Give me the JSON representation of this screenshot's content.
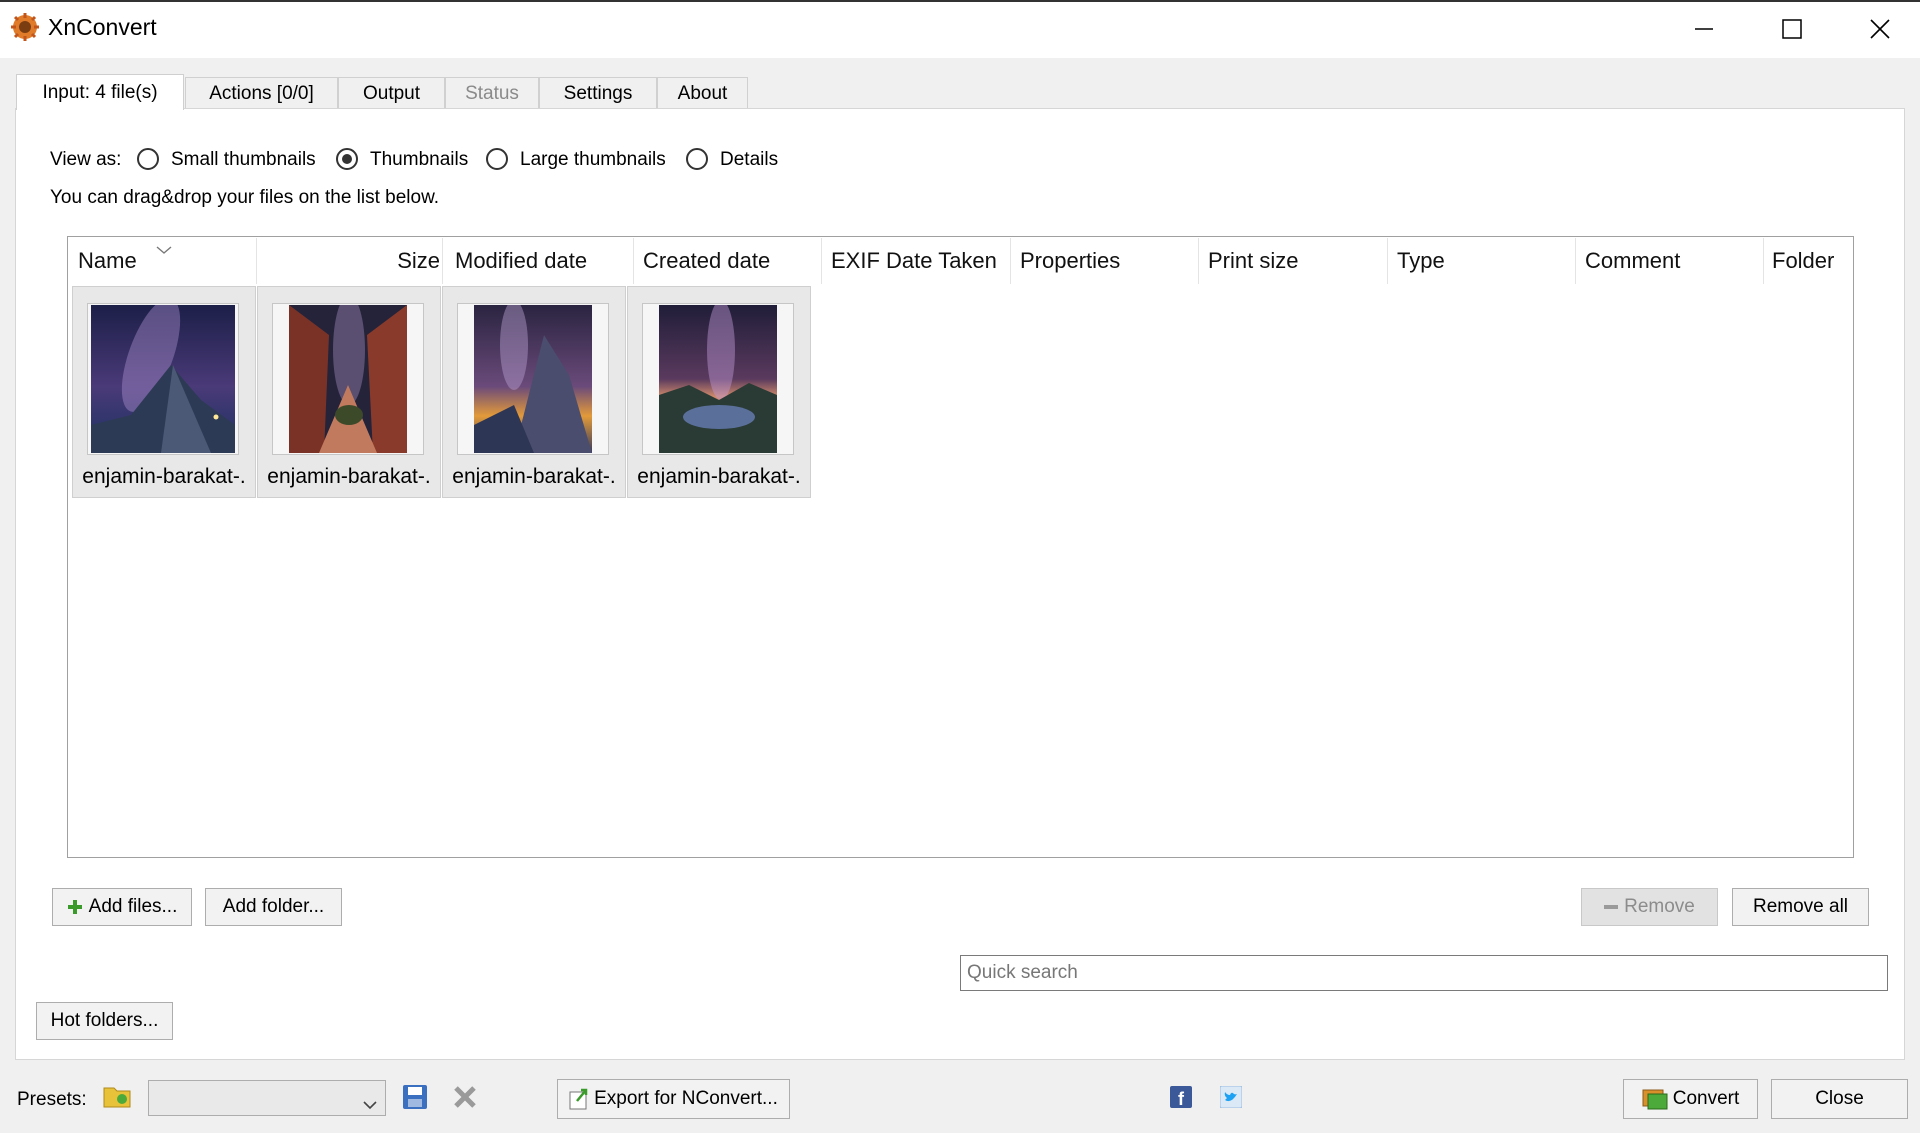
{
  "window": {
    "title": "XnConvert"
  },
  "tabs": [
    {
      "label": "Input: 4 file(s)",
      "active": true
    },
    {
      "label": "Actions [0/0]"
    },
    {
      "label": "Output"
    },
    {
      "label": "Status",
      "disabled": true
    },
    {
      "label": "Settings"
    },
    {
      "label": "About"
    }
  ],
  "view": {
    "label": "View as:",
    "options": [
      "Small thumbnails",
      "Thumbnails",
      "Large thumbnails",
      "Details"
    ],
    "selected": "Thumbnails",
    "hint": "You can drag&drop your files on the list below."
  },
  "columns": [
    "Name",
    "Size",
    "Modified date",
    "Created date",
    "EXIF Date Taken",
    "Properties",
    "Print size",
    "Type",
    "Comment",
    "Folder"
  ],
  "files": [
    {
      "name": "enjamin-barakat-."
    },
    {
      "name": "enjamin-barakat-."
    },
    {
      "name": "enjamin-barakat-."
    },
    {
      "name": "enjamin-barakat-."
    }
  ],
  "buttons": {
    "add_files": "Add files...",
    "add_folder": "Add folder...",
    "remove": "Remove",
    "remove_all": "Remove all",
    "hot_folders": "Hot folders...",
    "export": "Export for NConvert...",
    "convert": "Convert",
    "close": "Close"
  },
  "search": {
    "placeholder": "Quick search"
  },
  "presets": {
    "label": "Presets:",
    "value": ""
  },
  "icons": [
    "app-logo-icon",
    "minimize-icon",
    "maximize-icon",
    "close-window-icon",
    "plus-icon",
    "minus-icon",
    "folder-icon",
    "save-icon",
    "delete-icon",
    "export-icon",
    "facebook-icon",
    "twitter-icon",
    "convert-icon",
    "dropdown-arrow-icon",
    "sort-arrow-icon"
  ],
  "colors": {
    "facebook": "#3b5998",
    "twitter": "#1da1f2",
    "add_icon": "#3a9a2a"
  }
}
